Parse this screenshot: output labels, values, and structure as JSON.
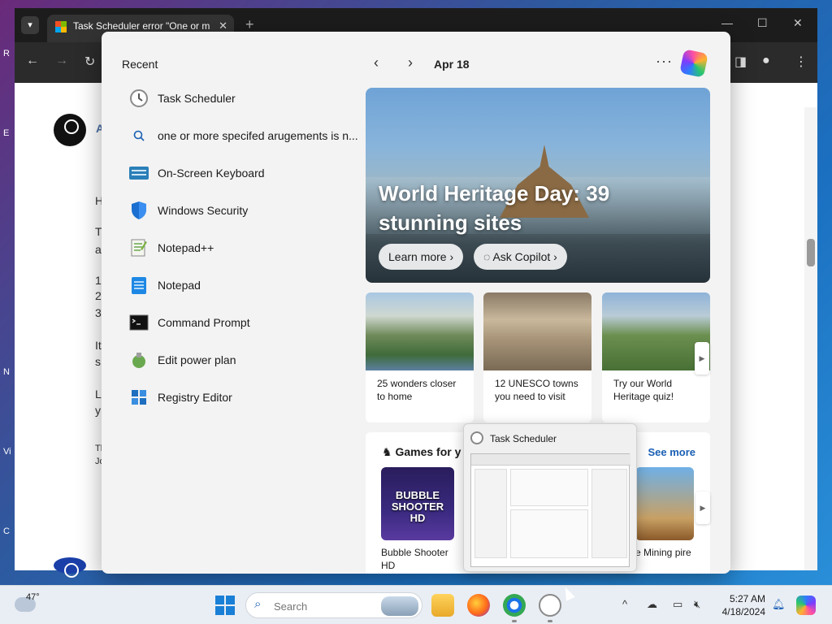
{
  "browser": {
    "tab_title": "Task Scheduler error \"One or m",
    "tab_close": "✕",
    "tab_new": "+",
    "page_letters": [
      "A",
      "H",
      "T",
      "a",
      "1",
      "2",
      "3",
      "It",
      "s",
      "L",
      "y",
      "Tl",
      "Jo"
    ]
  },
  "desktop_labels": [
    "R",
    "E",
    "N",
    "Vi",
    "C"
  ],
  "widgets": {
    "recent_title": "Recent",
    "recent_items": [
      {
        "label": "Task Scheduler"
      },
      {
        "label": "one or more specifed arugements is n..."
      },
      {
        "label": "On-Screen Keyboard"
      },
      {
        "label": "Windows Security"
      },
      {
        "label": "Notepad++"
      },
      {
        "label": "Notepad"
      },
      {
        "label": "Command Prompt"
      },
      {
        "label": "Edit power plan"
      },
      {
        "label": "Registry Editor"
      }
    ],
    "date": "Apr 18",
    "more": "···",
    "hero": {
      "title": "World Heritage Day: 39 stunning sites",
      "learn_more": "Learn more",
      "ask_copilot": "Ask Copilot"
    },
    "cards": [
      {
        "text": "25 wonders closer to home"
      },
      {
        "text": "12 UNESCO towns you need to visit"
      },
      {
        "text": "Try our World Heritage quiz!"
      }
    ],
    "games": {
      "title": "Games for y",
      "see_more": "See more",
      "items": [
        {
          "label": "Bubble Shooter HD",
          "thumb_text": "BUBBLE SHOOTER HD"
        },
        {
          "label": "e Mining pire"
        }
      ]
    }
  },
  "preview": {
    "title": "Task Scheduler"
  },
  "taskbar": {
    "weather_temp": "47°",
    "search_placeholder": "Search",
    "time": "5:27 AM",
    "date": "4/18/2024",
    "tray_chevron": "^"
  },
  "colors": {
    "accent": "#1a7fd6",
    "link": "#1a5fb4"
  }
}
